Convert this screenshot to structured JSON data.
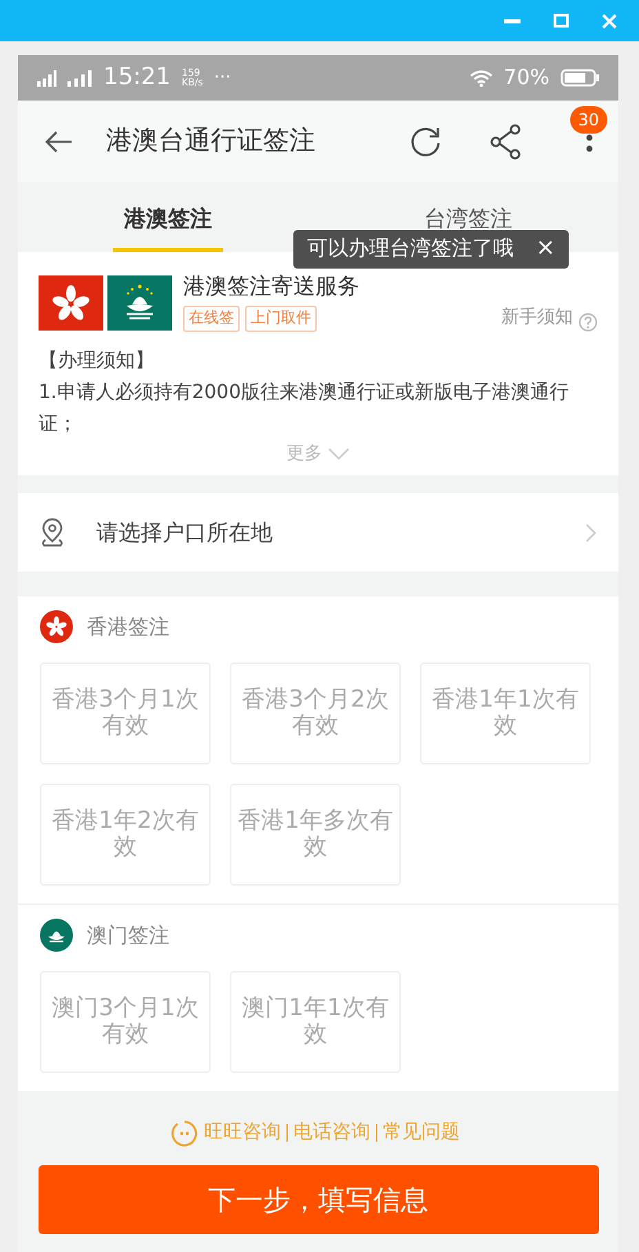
{
  "status_bar": {
    "time": "15:21",
    "speed": "159",
    "speed_unit": "KB/s",
    "more": "···",
    "battery": "70%"
  },
  "header": {
    "title": "港澳台通行证签注",
    "badge": "30"
  },
  "tabs": [
    {
      "label": "港澳签注",
      "selected": true
    },
    {
      "label": "台湾签注",
      "selected": false
    }
  ],
  "tooltip": {
    "text": "可以办理台湾签注了哦",
    "close": "×"
  },
  "service": {
    "title": "港澳签注寄送服务",
    "tags": [
      "在线签",
      "上门取件"
    ],
    "help_link": "新手须知"
  },
  "notice": {
    "heading": "【办理须知】",
    "text": "1.申请人必须持有2000版往来港澳通行证或新版电子港澳通行证；",
    "more": "更多"
  },
  "location": {
    "label": "请选择户口所在地"
  },
  "sections": [
    {
      "kind": "hk",
      "title": "香港签注",
      "options": [
        {
          "label": "香港3个月1次有效",
          "disabled": true
        },
        {
          "label": "香港3个月2次有效",
          "disabled": true
        },
        {
          "label": "香港1年1次有效",
          "disabled": true
        },
        {
          "label": "香港1年2次有效",
          "disabled": true
        },
        {
          "label": "香港1年多次有效",
          "disabled": true
        }
      ]
    },
    {
      "kind": "mo",
      "title": "澳门签注",
      "options": [
        {
          "label": "澳门3个月1次有效",
          "disabled": true
        },
        {
          "label": "澳门1年1次有效",
          "disabled": true
        }
      ]
    }
  ],
  "footer_links": [
    "旺旺咨询",
    "电话咨询",
    "常见问题"
  ],
  "next_button": "下一步，填写信息"
}
